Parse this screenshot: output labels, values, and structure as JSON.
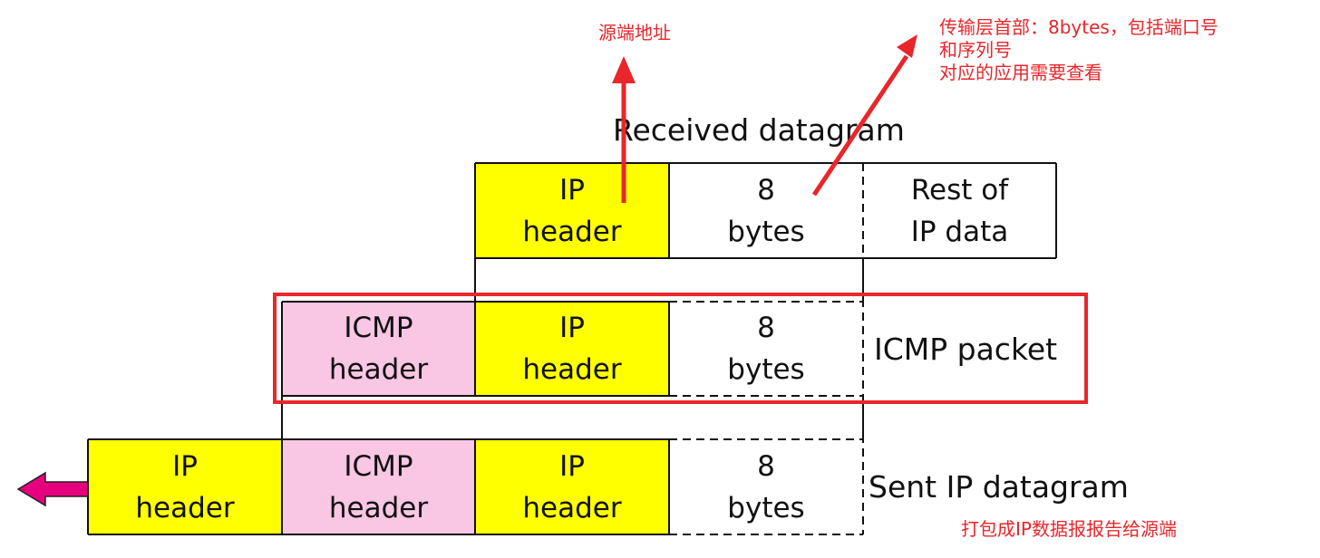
{
  "annotations": {
    "source_address": "源端地址",
    "transport_header_line1": "传输层首部：8bytes，包括端口号",
    "transport_header_line2": "和序列号",
    "transport_header_line3": "对应的应用需要查看",
    "pack_note": "打包成IP数据报报告给源端"
  },
  "labels": {
    "received_datagram": "Received datagram",
    "icmp_packet": "ICMP packet",
    "sent_ip_datagram": "Sent IP datagram"
  },
  "cells": {
    "ip": [
      "IP",
      "header"
    ],
    "icmp": [
      "ICMP",
      "header"
    ],
    "eight": [
      "8",
      "bytes"
    ],
    "rest": [
      "Rest of",
      "IP data"
    ]
  },
  "colors": {
    "ip_header": "#ffff00",
    "icmp_header": "#f9c6e3",
    "annotation": "#e8262b",
    "highlight_box": "#e8262b",
    "send_arrow": "#e6007e"
  }
}
